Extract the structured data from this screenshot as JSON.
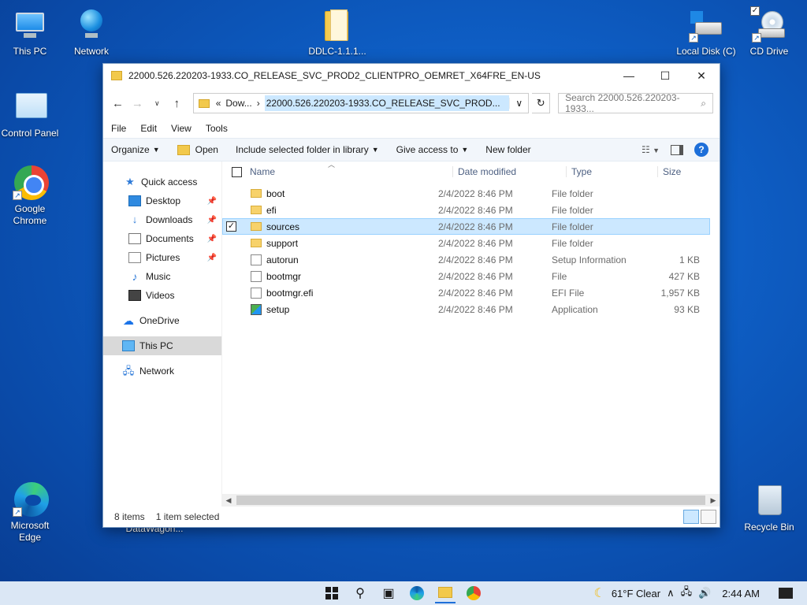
{
  "desktop": {
    "icons": {
      "this_pc": "This PC",
      "network": "Network",
      "ddlc": "DDLC-1.1.1...",
      "local_disk": "Local Disk (C)",
      "cd_drive": "CD Drive",
      "control_panel": "Control Panel",
      "chrome": "Google Chrome",
      "edge": "Microsoft Edge",
      "recycle_bin": "Recycle Bin",
      "hidden_label": "DataWagon..."
    }
  },
  "window": {
    "title": "22000.526.220203-1933.CO_RELEASE_SVC_PROD2_CLIENTPRO_OEMRET_X64FRE_EN-US",
    "controls": {
      "minimize": "—",
      "maximize": "☐",
      "close": "✕"
    },
    "address": {
      "prefix": "«",
      "parent": "Dow...",
      "current": "22000.526.220203-1933.CO_RELEASE_SVC_PROD..."
    },
    "search_placeholder": "Search 22000.526.220203-1933...",
    "menu": [
      "File",
      "Edit",
      "View",
      "Tools"
    ],
    "commands": {
      "organize": "Organize",
      "open": "Open",
      "include": "Include selected folder in library",
      "give_access": "Give access to",
      "new_folder": "New folder"
    },
    "nav": {
      "quick_access": "Quick access",
      "desktop": "Desktop",
      "downloads": "Downloads",
      "documents": "Documents",
      "pictures": "Pictures",
      "music": "Music",
      "videos": "Videos",
      "onedrive": "OneDrive",
      "this_pc": "This PC",
      "network": "Network"
    },
    "columns": {
      "name": "Name",
      "date": "Date modified",
      "type": "Type",
      "size": "Size"
    },
    "files": [
      {
        "name": "boot",
        "date": "2/4/2022 8:46 PM",
        "type": "File folder",
        "size": ""
      },
      {
        "name": "efi",
        "date": "2/4/2022 8:46 PM",
        "type": "File folder",
        "size": ""
      },
      {
        "name": "sources",
        "date": "2/4/2022 8:46 PM",
        "type": "File folder",
        "size": ""
      },
      {
        "name": "support",
        "date": "2/4/2022 8:46 PM",
        "type": "File folder",
        "size": ""
      },
      {
        "name": "autorun",
        "date": "2/4/2022 8:46 PM",
        "type": "Setup Information",
        "size": "1 KB"
      },
      {
        "name": "bootmgr",
        "date": "2/4/2022 8:46 PM",
        "type": "File",
        "size": "427 KB"
      },
      {
        "name": "bootmgr.efi",
        "date": "2/4/2022 8:46 PM",
        "type": "EFI File",
        "size": "1,957 KB"
      },
      {
        "name": "setup",
        "date": "2/4/2022 8:46 PM",
        "type": "Application",
        "size": "93 KB"
      }
    ],
    "status": {
      "count": "8 items",
      "selected": "1 item selected"
    }
  },
  "taskbar": {
    "weather": "61°F  Clear",
    "time": "2:44 AM"
  },
  "colors": {
    "accent": "#1e6fd9",
    "selection": "#cce8ff",
    "desktop": "#0e5fc6"
  }
}
